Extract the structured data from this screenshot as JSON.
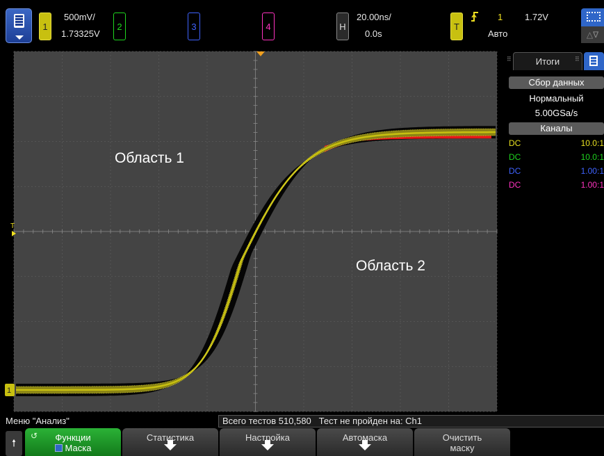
{
  "top_bar": {
    "menu_icon": "document-menu-icon",
    "ch1": {
      "label": "1",
      "scale": "500mV/",
      "offset": "1.73325V",
      "color": "#c8c010"
    },
    "ch2": {
      "label": "2",
      "color": "#1fd61f"
    },
    "ch3": {
      "label": "3",
      "color": "#3f63ff"
    },
    "ch4": {
      "label": "4",
      "color": "#ff33c0"
    },
    "horizontal": {
      "label": "H",
      "scale": "20.00ns/",
      "delay": "0.0s"
    },
    "trigger": {
      "label": "T",
      "slope_icon": "rising-edge-icon",
      "source": "1",
      "level": "1.72V",
      "mode": "Авто"
    },
    "cursor_icons": [
      "zoom-select-icon",
      "measure-delta-icon"
    ],
    "cursor_lower_glyph": "△∇"
  },
  "screen": {
    "ground_marker": "1",
    "trigger_marker": "T",
    "region1_label": "Область 1",
    "region2_label": "Область 2",
    "trace_color": "#c8c010",
    "fail_color": "#ff1a1a"
  },
  "side_panel": {
    "tab_label": "Итоги",
    "tab_icon": "document-icon",
    "acq_header": "Сбор данных",
    "acq_mode": "Нормальный",
    "sample_rate": "5.00GSa/s",
    "channels_header": "Каналы",
    "channels": [
      {
        "coupling": "DC",
        "probe": "10.0:1",
        "color": "#e8e020"
      },
      {
        "coupling": "DC",
        "probe": "10.0:1",
        "color": "#1fd61f"
      },
      {
        "coupling": "DC",
        "probe": "1.00:1",
        "color": "#3f63ff"
      },
      {
        "coupling": "DC",
        "probe": "1.00:1",
        "color": "#ff33c0"
      }
    ]
  },
  "status": {
    "menu_name": "Меню \"Анализ\"",
    "total_tests": "Всего тестов 510,580",
    "failed_on": "Тест не пройден на: Ch1"
  },
  "softkeys": {
    "back_icon": "up-arrow-icon",
    "functions": {
      "label": "Функции",
      "sub": "Маска"
    },
    "statistics": "Статистика",
    "setup": "Настройка",
    "automask": "Автомаска",
    "clear_mask_l1": "Очистить",
    "clear_mask_l2": "маску"
  }
}
